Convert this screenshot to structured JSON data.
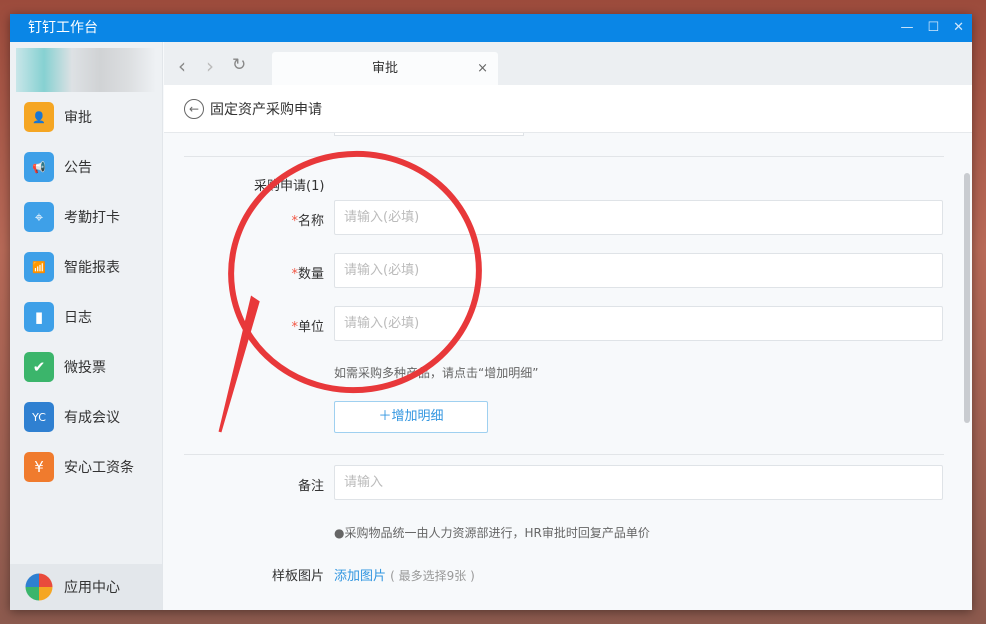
{
  "window": {
    "title": "钉钉工作台",
    "minimize": "—",
    "maximize": "☐",
    "close": "✕"
  },
  "sidebar": {
    "items": [
      {
        "label": "审批",
        "color": "#f5a623",
        "icon": "person-icon",
        "glyph": "👤"
      },
      {
        "label": "公告",
        "color": "#3ea0e8",
        "icon": "megaphone-icon",
        "glyph": "📢"
      },
      {
        "label": "考勤打卡",
        "color": "#3ea0e8",
        "icon": "location-icon",
        "glyph": "⌖"
      },
      {
        "label": "智能报表",
        "color": "#3ea0e8",
        "icon": "chart-icon",
        "glyph": "📶"
      },
      {
        "label": "日志",
        "color": "#3ea0e8",
        "icon": "notebook-icon",
        "glyph": "▮"
      },
      {
        "label": "微投票",
        "color": "#3bb56b",
        "icon": "vote-icon",
        "glyph": "✔"
      },
      {
        "label": "有成会议",
        "color": "#2f80d1",
        "icon": "meeting-icon",
        "glyph": "YC"
      },
      {
        "label": "安心工资条",
        "color": "#f07b2d",
        "icon": "payslip-icon",
        "glyph": "¥"
      }
    ],
    "app_center": "应用中心"
  },
  "tabs": [
    {
      "label": "审批",
      "close": "×"
    }
  ],
  "header": {
    "title": "固定资产采购申请"
  },
  "form": {
    "section_title": "采购申请(1)",
    "required_mark": "*",
    "fields": [
      {
        "label": "名称",
        "placeholder": "请输入(必填)"
      },
      {
        "label": "数量",
        "placeholder": "请输入(必填)"
      },
      {
        "label": "单位",
        "placeholder": "请输入(必填)"
      }
    ],
    "multi_hint": "如需采购多种产品，请点击“增加明细”",
    "add_detail": "＋增加明细",
    "remark_label": "备注",
    "remark_placeholder": "请输入",
    "remark_hint": "●采购物品统一由人力资源部进行，HR审批时回复产品单价",
    "image_label": "样板图片",
    "image_link": "添加图片",
    "image_hint": "( 最多选择9张 )"
  }
}
